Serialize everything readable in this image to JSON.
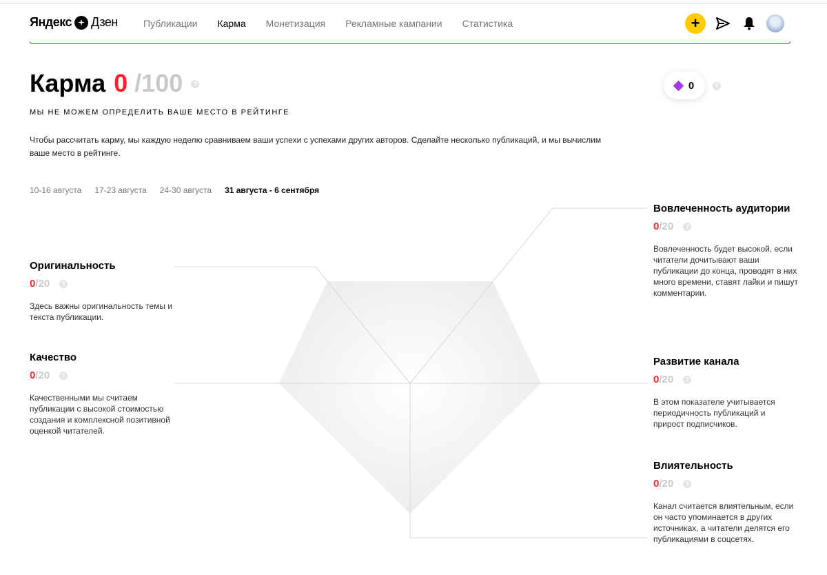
{
  "header": {
    "logo_brand": "Яндекс",
    "logo_product": "Дзен",
    "nav": [
      "Публикации",
      "Карма",
      "Монетизация",
      "Рекламные кампании",
      "Статистика"
    ],
    "active_nav": "Карма",
    "plus_label": "+"
  },
  "karma": {
    "title": "Карма",
    "score": "0",
    "max": "/100",
    "help": "?",
    "rank_note": "МЫ НЕ МОЖЕМ ОПРЕДЕЛИТЬ ВАШЕ МЕСТО В РЕЙТИНГЕ",
    "description": "Чтобы рассчитать карму, мы каждую неделю сравниваем ваши успехи с успехами других авторов. Сделайте несколько публикаций, и мы вычислим ваше место в рейтинге."
  },
  "badge": {
    "value": "0",
    "help": "?"
  },
  "weeks": [
    "10-16 августа",
    "17-23 августа",
    "24-30 августа",
    "31 августа - 6 сентября"
  ],
  "selected_week": "31 августа - 6 сентября",
  "metrics": {
    "originality": {
      "title": "Оригинальность",
      "value": "0",
      "max": "/20",
      "help": "?",
      "description": "Здесь важны оригинальность темы и текста публикации."
    },
    "quality": {
      "title": "Качество",
      "value": "0",
      "max": "/20",
      "help": "?",
      "description": "Качественными мы считаем публикации с высокой стоимостью создания и комплексной позитивной оценкой читателей."
    },
    "engagement": {
      "title": "Вовлеченность аудитории",
      "value": "0",
      "max": "/20",
      "help": "?",
      "description": "Вовлеченность будет высокой, если читатели дочитывают ваши публикации до конца, проводят в них много времени, ставят лайки и пишут комментарии."
    },
    "development": {
      "title": "Развитие канала",
      "value": "0",
      "max": "/20",
      "help": "?",
      "description": "В этом показателе учитывается периодичность публикаций и прирост подписчиков."
    },
    "influence": {
      "title": "Влиятельность",
      "value": "0",
      "max": "/20",
      "help": "?",
      "description": "Канал считается влиятельным, если он часто упоминается в других источниках, а читатели делятся его публикациями в соцсетях."
    }
  },
  "colors": {
    "accent_red": "#ff1e2a",
    "yellow": "#ffcc00",
    "diamond": "#a837e8",
    "muted": "#c9c9c9"
  }
}
